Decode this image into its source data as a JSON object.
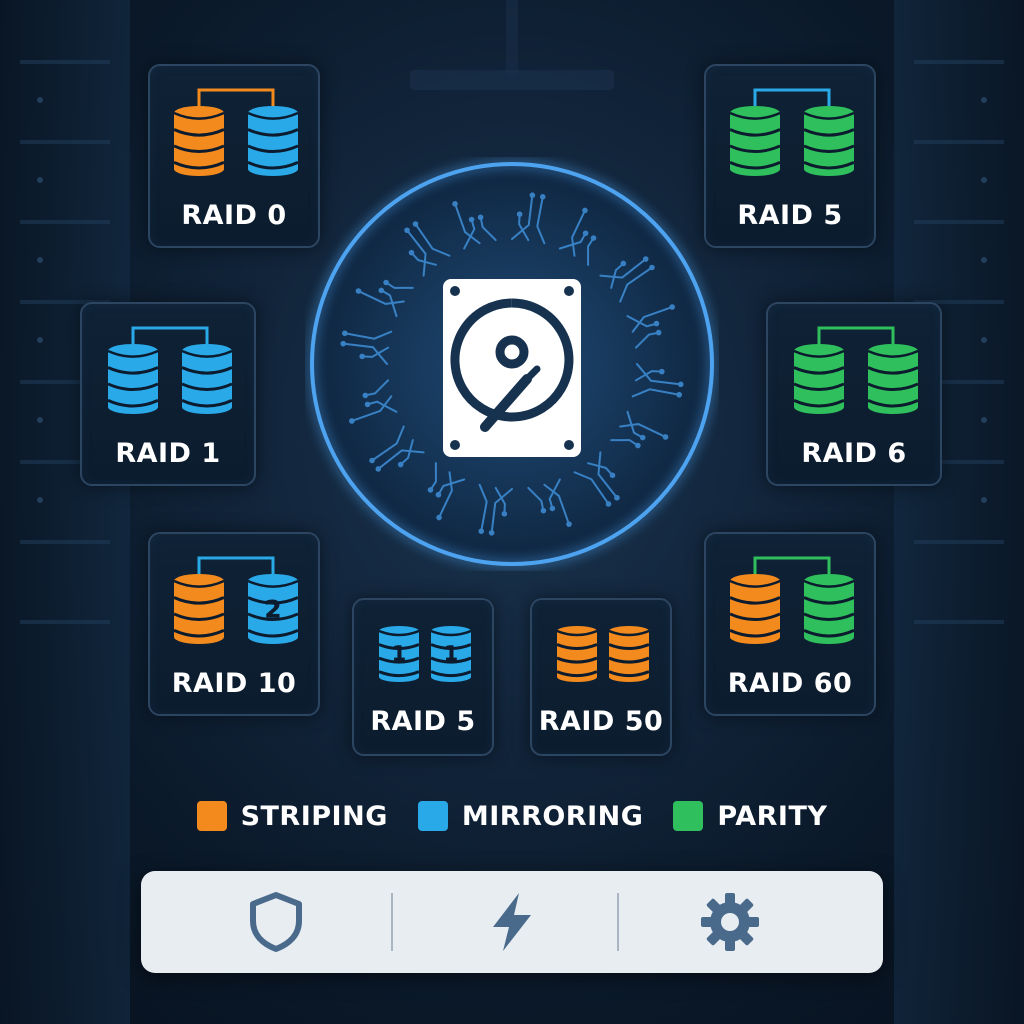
{
  "raid_cards": [
    {
      "id": "raid-0",
      "label": "RAID 0",
      "disks": [
        "striping",
        "mirroring"
      ],
      "connector": "striping",
      "marks": [
        "",
        ""
      ]
    },
    {
      "id": "raid-5-top",
      "label": "RAID 5",
      "disks": [
        "parity",
        "parity"
      ],
      "connector": "mirroring",
      "marks": [
        "",
        ""
      ]
    },
    {
      "id": "raid-1",
      "label": "RAID 1",
      "disks": [
        "mirroring",
        "mirroring"
      ],
      "connector": "mirroring",
      "marks": [
        "",
        ""
      ]
    },
    {
      "id": "raid-6",
      "label": "RAID 6",
      "disks": [
        "parity",
        "parity"
      ],
      "connector": "parity",
      "marks": [
        "",
        ""
      ]
    },
    {
      "id": "raid-10",
      "label": "RAID 10",
      "disks": [
        "striping",
        "mirroring"
      ],
      "connector": "mirroring",
      "marks": [
        "",
        "2"
      ]
    },
    {
      "id": "raid-60",
      "label": "RAID 60",
      "disks": [
        "striping",
        "parity"
      ],
      "connector": "parity",
      "marks": [
        "",
        ""
      ]
    },
    {
      "id": "raid-5-bottom",
      "label": "RAID 5",
      "disks": [
        "mirroring",
        "mirroring"
      ],
      "connector": "",
      "marks": [
        "1",
        "1"
      ]
    },
    {
      "id": "raid-50",
      "label": "RAID 50",
      "disks": [
        "striping",
        "striping"
      ],
      "connector": "",
      "marks": [
        "",
        ""
      ]
    }
  ],
  "legend": [
    {
      "key": "striping",
      "label": "STRIPING",
      "color": "#f28a1e"
    },
    {
      "key": "mirroring",
      "label": "MIRRORING",
      "color": "#29a9e8"
    },
    {
      "key": "parity",
      "label": "PARITY",
      "color": "#2fbf5c"
    }
  ],
  "toolbar": [
    {
      "icon": "shield-icon",
      "action": "protection"
    },
    {
      "icon": "lightning-icon",
      "action": "performance"
    },
    {
      "icon": "gear-icon",
      "action": "settings"
    }
  ],
  "center": {
    "icon": "hard-drive-icon"
  },
  "colors": {
    "accent": "#3d8fe0",
    "card_border": "#2c4560",
    "background": "#0d1e31"
  }
}
